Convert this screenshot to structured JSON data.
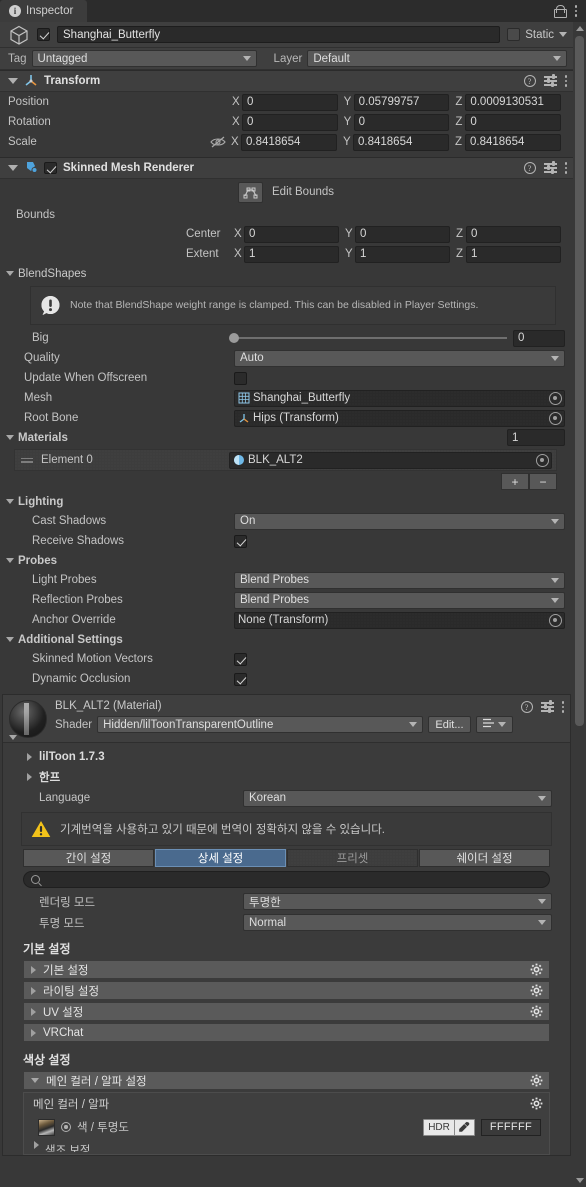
{
  "window": {
    "tab_label": "Inspector",
    "tab_icon": "info-icon",
    "lock_icon": "lock-icon",
    "menu_icon": "kebab-menu-icon"
  },
  "gameobject": {
    "enabled": true,
    "name": "Shanghai_Butterfly",
    "static_label": "Static",
    "static_checked": false,
    "tag_label": "Tag",
    "tag_value": "Untagged",
    "layer_label": "Layer",
    "layer_value": "Default"
  },
  "transform": {
    "title": "Transform",
    "rows": [
      {
        "label": "Position",
        "x": "0",
        "y": "0.05799757",
        "z": "0.0009130531"
      },
      {
        "label": "Rotation",
        "x": "0",
        "y": "0",
        "z": "0"
      },
      {
        "label": "Scale",
        "x": "0.8418654",
        "y": "0.8418654",
        "z": "0.8418654"
      }
    ],
    "axis_x": "X",
    "axis_y": "Y",
    "axis_z": "Z"
  },
  "smr": {
    "title": "Skinned Mesh Renderer",
    "enabled": true,
    "edit_bounds_label": "Edit Bounds",
    "bounds_label": "Bounds",
    "center_label": "Center",
    "extent_label": "Extent",
    "center": {
      "x": "0",
      "y": "0",
      "z": "0"
    },
    "extent": {
      "x": "1",
      "y": "1",
      "z": "1"
    },
    "blendshapes_label": "BlendShapes",
    "blendshape_note": "Note that BlendShape weight range is clamped. This can be disabled in Player Settings.",
    "blendshape_name": "Big",
    "blendshape_value": "0",
    "quality_label": "Quality",
    "quality_value": "Auto",
    "update_offscreen_label": "Update When Offscreen",
    "update_offscreen_checked": false,
    "mesh_label": "Mesh",
    "mesh_value": "Shanghai_Butterfly",
    "root_bone_label": "Root Bone",
    "root_bone_value": "Hips (Transform)",
    "materials_label": "Materials",
    "materials_count": "1",
    "material_element_label": "Element 0",
    "material_element_value": "BLK_ALT2",
    "add_label": "+",
    "remove_label": "−",
    "lighting_label": "Lighting",
    "cast_shadows_label": "Cast Shadows",
    "cast_shadows_value": "On",
    "receive_shadows_label": "Receive Shadows",
    "receive_shadows_checked": true,
    "probes_label": "Probes",
    "light_probes_label": "Light Probes",
    "light_probes_value": "Blend Probes",
    "reflection_probes_label": "Reflection Probes",
    "reflection_probes_value": "Blend Probes",
    "anchor_override_label": "Anchor Override",
    "anchor_override_value": "None (Transform)",
    "additional_settings_label": "Additional Settings",
    "skinned_motion_vectors_label": "Skinned Motion Vectors",
    "skinned_motion_vectors_checked": true,
    "dynamic_occlusion_label": "Dynamic Occlusion",
    "dynamic_occlusion_checked": true
  },
  "material": {
    "title": "BLK_ALT2 (Material)",
    "shader_label": "Shader",
    "shader_value": "Hidden/lilToonTransparentOutline",
    "edit_button": "Edit...",
    "liltoon_version": "lilToon 1.7.3",
    "help_label": "한프",
    "language_label": "Language",
    "language_value": "Korean",
    "translation_warning": "기계번역을 사용하고 있기 때문에 번역이 정확하지 않을 수 있습니다.",
    "tabs": [
      {
        "label": "간이 설정",
        "selected": false,
        "ghost": false
      },
      {
        "label": "상세 설정",
        "selected": true,
        "ghost": false
      },
      {
        "label": "프리셋",
        "selected": false,
        "ghost": true
      },
      {
        "label": "쉐이더 설정",
        "selected": false,
        "ghost": false
      }
    ],
    "search_placeholder": "",
    "render_mode_label": "렌더링 모드",
    "render_mode_value": "투명한",
    "transparent_mode_label": "투명 모드",
    "transparent_mode_value": "Normal",
    "basic_section_title": "기본 설정",
    "basic_foldouts": [
      {
        "label": "기본 설정",
        "gear": true
      },
      {
        "label": "라이팅 설정",
        "gear": true
      },
      {
        "label": "UV 설정",
        "gear": true
      },
      {
        "label": "VRChat",
        "gear": false
      }
    ],
    "color_section_title": "색상 설정",
    "main_color_foldout": "메인 컬러 / 알파 설정",
    "main_color_group": "메인 컬러 / 알파",
    "color_alpha_label": "색 / 투명도",
    "hdr_label": "HDR",
    "color_hex": "FFFFFF",
    "partial_row_label": "색조 보정"
  }
}
